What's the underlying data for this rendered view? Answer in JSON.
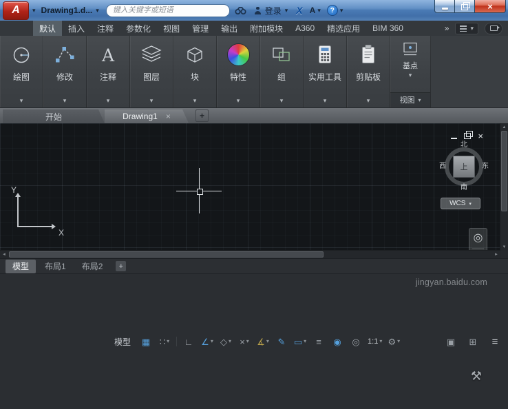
{
  "titlebar": {
    "app_button_label": "A",
    "title": "Drawing1.d...",
    "search_placeholder": "键入关键字或短语",
    "sign_in_label": "登录",
    "a360_label": "X",
    "apps_label": "A",
    "help_label": "?"
  },
  "ribbon": {
    "tabs": [
      "默认",
      "插入",
      "注释",
      "参数化",
      "视图",
      "管理",
      "输出",
      "附加模块",
      "A360",
      "精选应用",
      "BIM 360"
    ],
    "annotate_glyph": "A",
    "panels": [
      {
        "label": "绘图"
      },
      {
        "label": "修改"
      },
      {
        "label": "注释"
      },
      {
        "label": "图层"
      },
      {
        "label": "块"
      },
      {
        "label": "特性"
      },
      {
        "label": "组"
      },
      {
        "label": "实用工具"
      },
      {
        "label": "剪贴板"
      },
      {
        "label": "基点"
      }
    ],
    "view_panel_title": "视图"
  },
  "file_tabs": {
    "start_label": "开始",
    "drawing_label": "Drawing1"
  },
  "canvas": {
    "viewcube": {
      "north": "北",
      "south": "南",
      "east": "东",
      "west": "西",
      "top": "上"
    },
    "wcs_label": "WCS",
    "ucs_x": "X",
    "ucs_y": "Y"
  },
  "layout_tabs": {
    "model_label": "模型",
    "layout1_label": "布局1",
    "layout2_label": "布局2"
  },
  "statusbar": {
    "model_label": "模型",
    "scale_label": "1:1",
    "watermark": "jingyan.baidu.com",
    "glyphs": {
      "grid": "▦",
      "snap": "∷",
      "ortho": "∟",
      "polar": "∠",
      "iso": "◇",
      "otrack": "×",
      "osnap": "∡",
      "dyn": "✎",
      "lineweight": "▭",
      "transparency": "≡",
      "annot_vis": "◉",
      "autoscale": "◎",
      "workspace": "⚙",
      "isolate": "▣",
      "clean_screen": "⊞",
      "hamburger": "≡"
    }
  },
  "icons": {
    "caret": "▾",
    "overflow": "»",
    "close": "×",
    "plus": "+",
    "scroll_left": "◄",
    "scroll_right": "►",
    "scroll_up": "▲",
    "scroll_down": "▼",
    "nav_wheel": "◎",
    "nav_pan": "⊹",
    "nav_zoom": "⊕",
    "nav_orbit": "↻",
    "nav_motion": "▤",
    "jingyan_logo": "⚒"
  }
}
